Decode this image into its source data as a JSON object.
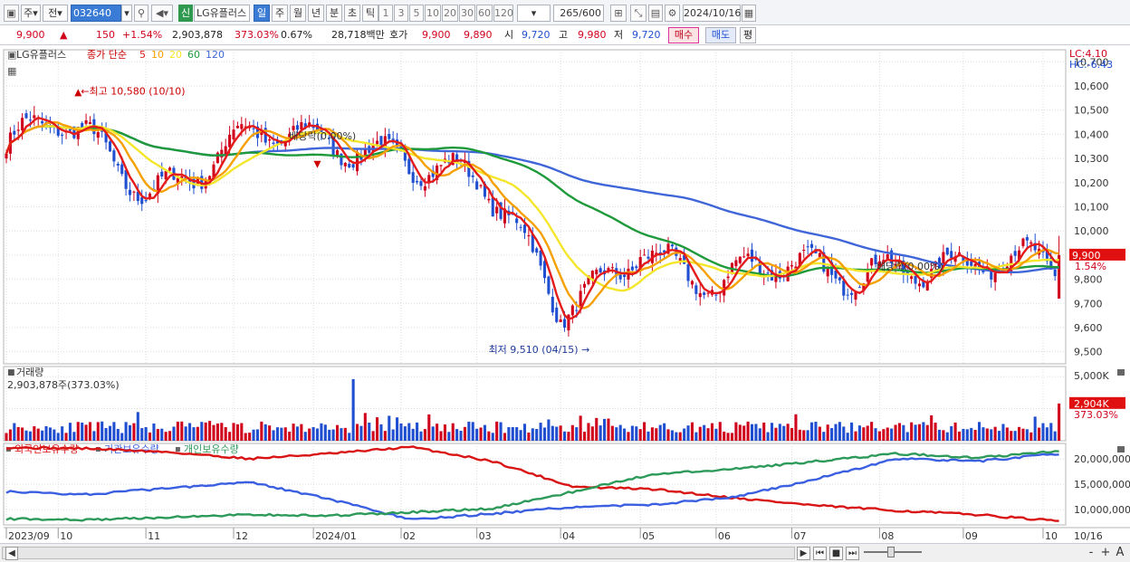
{
  "toolbar": {
    "period_label": "주",
    "prev_label": "전",
    "code": "032640",
    "new_label": "신",
    "stock_name": "LG유플러스",
    "timeframes": [
      "일",
      "주",
      "월",
      "년",
      "분",
      "초",
      "틱"
    ],
    "active_timeframe": "일",
    "intervals": [
      "1",
      "3",
      "5",
      "10",
      "20",
      "30",
      "60",
      "120"
    ],
    "count": "265",
    "count_total": "/600",
    "date": "2024/10/16"
  },
  "quote": {
    "price": "9,900",
    "arrow": "▲",
    "change": "150",
    "change_pct": "+1.54%",
    "volume": "2,903,878",
    "volume_ratio": "373.03%",
    "turnover": "0.67%",
    "amount": "28,718백만",
    "hoga_label": "호가",
    "ask": "9,900",
    "bid": "9,890",
    "open_label": "시",
    "open": "9,720",
    "high_label": "고",
    "high": "9,980",
    "low_label": "저",
    "low": "9,720",
    "buy_label": "매수",
    "sell_label": "매도",
    "flat_label": "평"
  },
  "colors": {
    "up": "#d0021b",
    "down": "#1f4fd0",
    "ma5": "#e31b1b",
    "ma10": "#f5a000",
    "ma20": "#f4e62a",
    "ma60": "#1f9a3b",
    "ma120": "#3f66d8",
    "foreign": "#d81414",
    "institution": "#3a5fe0",
    "individual": "#2d9a5a"
  },
  "chart_data": [
    {
      "type": "candlestick",
      "title_stock": "LG유플러스",
      "legend_label": "종가 단순",
      "ma_periods": [
        "5",
        "10",
        "20",
        "60",
        "120"
      ],
      "lc_label": "LC:4.10",
      "hc_label": "HC:-6.43",
      "ylim": [
        9450,
        10750
      ],
      "y_ticks": [
        "10,700",
        "10,600",
        "10,500",
        "10,400",
        "10,300",
        "10,200",
        "10,100",
        "10,000",
        "9,900",
        "9,800",
        "9,700",
        "9,600",
        "9,500"
      ],
      "last_price_label": "9,900",
      "last_change_label": "1.54%",
      "high_annotation": "최고 10,580 (10/10)",
      "low_annotation": "최저 9,510 (04/15)",
      "dividend_labels": [
        "배당락(0.00%)",
        "배당락(0.00%)"
      ],
      "high_value": 10580,
      "low_value": 9510,
      "close_anchor_months": [
        "2023/09",
        "10",
        "11",
        "12",
        "2024/01",
        "02",
        "03",
        "04",
        "05",
        "06",
        "07",
        "08",
        "09",
        "10",
        "10/16"
      ],
      "close_anchor_values": [
        10350,
        10400,
        10200,
        10380,
        10320,
        10380,
        10200,
        9640,
        10000,
        9720,
        9850,
        9900,
        9780,
        9900,
        9900
      ]
    },
    {
      "type": "bar",
      "title": "거래량",
      "volume_label": "2,903,878주(373.03%)",
      "y_ticks": [
        "5,000K",
        "2,500K"
      ],
      "last_label": "2,904K",
      "last_ratio": "373.03%",
      "ylim": [
        0,
        5500
      ],
      "last_value_k": 2904
    },
    {
      "type": "line",
      "series_names": [
        "외국인보유수량",
        "기관보유수량",
        "개인보유수량"
      ],
      "y_ticks": [
        "20,000,000",
        "15,000,000",
        "10,000,000"
      ],
      "ylim": [
        7000000,
        23000000
      ],
      "foreign_anchor_values": [
        22200000,
        22000000,
        21300000,
        20000000,
        21000000,
        22300000,
        19500000,
        14500000,
        14000000,
        12300000,
        10800000,
        9800000,
        9000000,
        7700000
      ],
      "institution_anchor_values": [
        13500000,
        13000000,
        14200000,
        15500000,
        12000000,
        8000000,
        9200000,
        10500000,
        11000000,
        12500000,
        16000000,
        20000000,
        19500000,
        21000000
      ],
      "individual_anchor_values": [
        8200000,
        8000000,
        8500000,
        9000000,
        8800000,
        9500000,
        10200000,
        13500000,
        17000000,
        18000000,
        19500000,
        21000000,
        20200000,
        21500000
      ]
    }
  ],
  "xaxis": {
    "labels": [
      "2023/09",
      "10",
      "11",
      "12",
      "2024/01",
      "02",
      "03",
      "04",
      "05",
      "06",
      "07",
      "08",
      "09",
      "10",
      "10/16"
    ]
  },
  "bottombar": {
    "nav": [
      "▶",
      "⏮",
      "■",
      "⏭"
    ],
    "zoom": [
      "-",
      "+",
      "A"
    ]
  }
}
